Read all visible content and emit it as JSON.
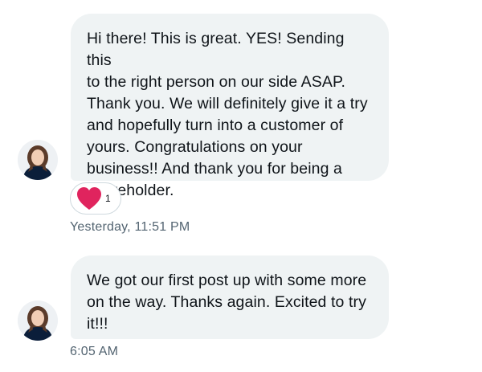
{
  "messages": [
    {
      "text": "Hi there! This is great. YES! Sending this\nto the right person on our side ASAP.\nThank you. We will definitely give it a try\nand hopefully turn into a customer of\nyours. Congratulations on your\nbusiness!! And thank you for being a\nshareholder.",
      "reaction": {
        "icon": "heart-icon",
        "count": "1",
        "color": "#e0245e"
      },
      "timestamp": "Yesterday, 11:51 PM"
    },
    {
      "text": "We got our first post up with some more\non the way. Thanks again. Excited to try\nit!!!",
      "timestamp": "6:05 AM"
    }
  ],
  "colors": {
    "bubble_bg": "#eff3f4",
    "timestamp": "#536471",
    "avatar_top": "#0b1e3a",
    "avatar_hair": "#5b3b2a"
  }
}
